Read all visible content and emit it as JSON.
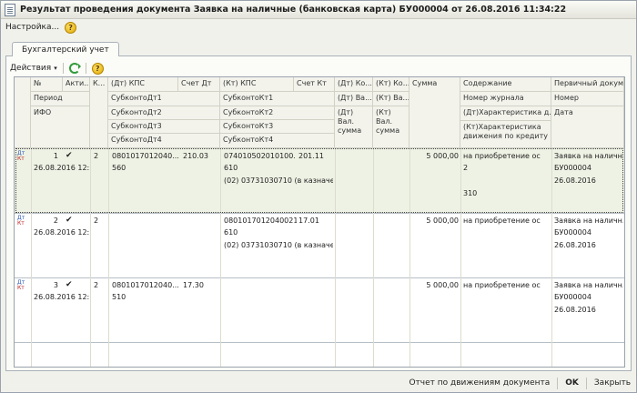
{
  "window": {
    "title": "Результат проведения документа Заявка на наличные (банковская карта) БУ000004 от 26.08.2016 11:34:22"
  },
  "menu": {
    "settings_label": "Настройка...",
    "help_label": "?"
  },
  "tabs": [
    {
      "label": "Бухгалтерский учет"
    }
  ],
  "toolbar": {
    "actions_label": "Действия",
    "help_label": "?"
  },
  "grid": {
    "headers": {
      "no": "№",
      "active": "Акти...",
      "k": "К...",
      "period": "Период",
      "ifo": "ИФО",
      "dt_kps": "(Дт) КПС",
      "dt_account": "Счет Дт",
      "dt_sub1": "СубконтоДт1",
      "dt_sub2": "СубконтоДт2",
      "dt_sub3": "СубконтоДт3",
      "dt_sub4": "СубконтоДт4",
      "kt_kps": "(Кт) КПС",
      "kt_account": "Счет Кт",
      "kt_sub1": "СубконтоКт1",
      "kt_sub2": "СубконтоКт2",
      "kt_sub3": "СубконтоКт3",
      "kt_sub4": "СубконтоКт4",
      "dt_ko": "(Дт) Ко...",
      "dt_va": "(Дт) Ва...",
      "dt_val_sum": "(Дт) Вал. сумма",
      "kt_ko": "(Кт) Ко...",
      "kt_va": "(Кт) Ва...",
      "kt_val_sum": "(Кт) Вал. сумма",
      "sum": "Сумма",
      "content": "Содержание",
      "journal_no": "Номер журнала",
      "dt_char": "(Дт)Характеристика д...",
      "kt_char": "(Кт)Характеристика движения по кредиту",
      "primary_doc": "Первичный докум...",
      "number": "Номер",
      "date": "Дата"
    },
    "rows": [
      {
        "no": "1",
        "active": "✔",
        "k": "2",
        "period": "26.08.2016 12:...",
        "dt_kps": "0801017012040...",
        "dt_account": "210.03",
        "dt_sub1": "560",
        "kt_kps": "074010502010100...",
        "kt_account": "201.11",
        "kt_sub1": "610",
        "kt_sub2": "(02) 03731030710 (в казначе...",
        "sum": "5 000,00",
        "content": "на приобретение ос",
        "dt_char": "2",
        "kt_char": "310",
        "primary_doc": "Заявка на наличн...",
        "number": "БУ000004",
        "date": "26.08.2016"
      },
      {
        "no": "2",
        "active": "✔",
        "k": "2",
        "period": "26.08.2016 12:...",
        "dt_kps": "",
        "dt_account": "",
        "dt_sub1": "",
        "kt_kps": "0801017012040021...",
        "kt_account": "17.01",
        "kt_sub1": "610",
        "kt_sub2": "(02) 03731030710 (в казначе...",
        "sum": "5 000,00",
        "content": "на приобретение ос",
        "dt_char": "",
        "kt_char": "",
        "primary_doc": "Заявка на наличн...",
        "number": "БУ000004",
        "date": "26.08.2016"
      },
      {
        "no": "3",
        "active": "✔",
        "k": "2",
        "period": "26.08.2016 12:...",
        "dt_kps": "0801017012040...",
        "dt_account": "17.30",
        "dt_sub1": "510",
        "kt_kps": "",
        "kt_account": "",
        "kt_sub1": "",
        "kt_sub2": "",
        "sum": "5 000,00",
        "content": "на приобретение ос",
        "dt_char": "",
        "kt_char": "",
        "primary_doc": "Заявка на наличн...",
        "number": "БУ000004",
        "date": "26.08.2016"
      }
    ]
  },
  "statusbar": {
    "report_label": "Отчет по движениям документа",
    "ok_label": "OK",
    "close_label": "Закрыть"
  }
}
